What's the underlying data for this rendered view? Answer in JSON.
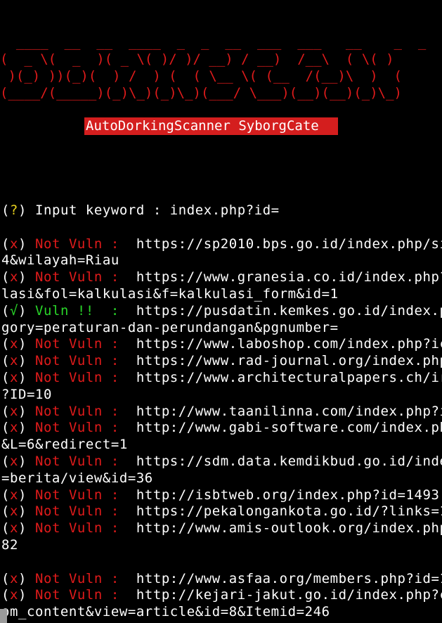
{
  "banner": {
    "line1": "  ____  __  __  ____  _  _  __  ___  ___   __    _  _",
    "line2": "(  _ \\(  _  )( _ \\( )/ )/ __) / __)  /__\\  ( \\( )",
    "line3": " )(_) ))(_)(  ) /  ) (  ( \\__ \\( (__  /(__)\\  )  (",
    "line4": "(____/(_____)(_)\\_)(_)\\_)(___/ \\___)(__)(__)(_)\\_)"
  },
  "title": "AutoDorkingScanner SyborgCate ",
  "prompt": {
    "marker_open": "(",
    "marker_symbol": "?",
    "marker_close": ")",
    "text": " Input keyword : index.php?id="
  },
  "lines": [
    {
      "kind": "result",
      "symbol": "x",
      "status": "Not Vuln :",
      "url": "  https://sp2010.bps.go.id/index.php/si"
    },
    {
      "kind": "cont",
      "text": "4&wilayah=Riau"
    },
    {
      "kind": "result",
      "symbol": "x",
      "status": "Not Vuln :",
      "url": "  https://www.granesia.co.id/index.php?"
    },
    {
      "kind": "cont",
      "text": "lasi&fol=kalkulasi&f=kalkulasi_form&id=1"
    },
    {
      "kind": "vuln",
      "symbol": "√",
      "status": "Vuln !!  :",
      "url": "  https://pusdatin.kemkes.go.id/index.p"
    },
    {
      "kind": "cont",
      "text": "gory=peraturan-dan-perundangan&pgnumber="
    },
    {
      "kind": "result",
      "symbol": "x",
      "status": "Not Vuln :",
      "url": "  https://www.laboshop.com/index.php?ic"
    },
    {
      "kind": "result",
      "symbol": "x",
      "status": "Not Vuln :",
      "url": "  https://www.rad-journal.org/index.php"
    },
    {
      "kind": "result",
      "symbol": "x",
      "status": "Not Vuln :",
      "url": "  https://www.architecturalpapers.ch/ir"
    },
    {
      "kind": "cont",
      "text": "?ID=10"
    },
    {
      "kind": "result",
      "symbol": "x",
      "status": "Not Vuln :",
      "url": "  http://www.taanilinna.com/index.php?i"
    },
    {
      "kind": "result",
      "symbol": "x",
      "status": "Not Vuln :",
      "url": "  http://www.gabi-software.com/index.ph"
    },
    {
      "kind": "cont",
      "text": "&L=6&redirect=1"
    },
    {
      "kind": "result",
      "symbol": "x",
      "status": "Not Vuln :",
      "url": "  https://sdm.data.kemdikbud.go.id/inde"
    },
    {
      "kind": "cont",
      "text": "=berita/view&id=36"
    },
    {
      "kind": "result",
      "symbol": "x",
      "status": "Not Vuln :",
      "url": "  http://isbtweb.org/index.php?id=1493"
    },
    {
      "kind": "result",
      "symbol": "x",
      "status": "Not Vuln :",
      "url": "  https://pekalongankota.go.id/?links=1"
    },
    {
      "kind": "result",
      "symbol": "x",
      "status": "Not Vuln :",
      "url": "  http://www.amis-outlook.org/index.php"
    },
    {
      "kind": "cont",
      "text": "82"
    },
    {
      "kind": "blank",
      "text": ""
    },
    {
      "kind": "result",
      "symbol": "x",
      "status": "Not Vuln :",
      "url": "  http://www.asfaa.org/members.php?id=1"
    },
    {
      "kind": "result",
      "symbol": "x",
      "status": "Not Vuln :",
      "url": "  http://kejari-jakut.go.id/index.php?c"
    },
    {
      "kind": "cont",
      "text": "om_content&view=article&id=8&Itemid=246"
    }
  ],
  "colors": {
    "background": "#000000",
    "banner": "#e01b1b",
    "title_bg": "#d41e1e",
    "not_vuln": "#e01b1b",
    "vuln": "#29d429",
    "prompt_marker": "#e8d21d",
    "text": "#ffffff"
  }
}
